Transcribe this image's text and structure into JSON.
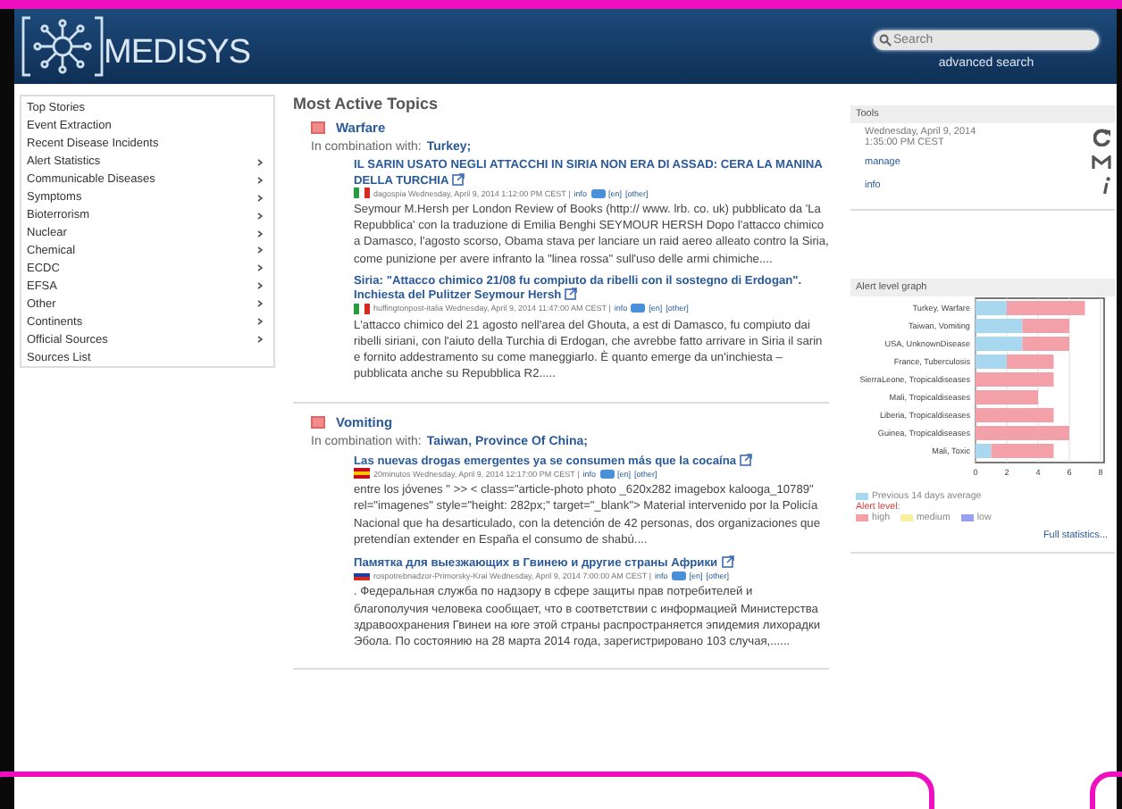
{
  "header": {
    "logo": "MEDISYS",
    "search": {
      "placeholder": "Search"
    },
    "advanced_search": "advanced search"
  },
  "sidebar": {
    "items": [
      {
        "label": "Top Stories",
        "has_submenu": false
      },
      {
        "label": "Event Extraction",
        "has_submenu": false
      },
      {
        "label": "Recent Disease Incidents",
        "has_submenu": false
      },
      {
        "label": "Alert Statistics",
        "has_submenu": true
      },
      {
        "label": "Communicable Diseases",
        "has_submenu": true
      },
      {
        "label": "Symptoms",
        "has_submenu": true
      },
      {
        "label": "Bioterrorism",
        "has_submenu": true
      },
      {
        "label": "Nuclear",
        "has_submenu": true
      },
      {
        "label": "Chemical",
        "has_submenu": true
      },
      {
        "label": "ECDC",
        "has_submenu": true
      },
      {
        "label": "EFSA",
        "has_submenu": true
      },
      {
        "label": "Other",
        "has_submenu": true
      },
      {
        "label": "Continents",
        "has_submenu": true
      },
      {
        "label": "Official Sources",
        "has_submenu": true
      },
      {
        "label": "Sources List",
        "has_submenu": false
      }
    ]
  },
  "main": {
    "title": "Most Active Topics",
    "topics": [
      {
        "name": "Warfare",
        "combination_label": "In combination with:",
        "combination": "Turkey;",
        "articles": [
          {
            "title": "IL SARIN USATO NEGLI ATTACCHI IN SIRIA NON ERA DI ASSAD: CERA LA MANINA DELLA TURCHIA",
            "kind": "it",
            "meta": "dagospia Wednesday, April 9, 2014 1:12:00 PM CEST |",
            "info": "info",
            "lang": "[en]",
            "other": "[other]",
            "body": "Seymour M.Hersh per London Review of Books (http:// www. lrb. co. uk) pubblicato da 'La Repubblica' con la traduzione di Emilia Benghi SEYMOUR HERSH Dopo l'attacco chimico a Damasco, l'agosto scorso, Obama stava per lanciare un raid aereo alleato contro la Siria, come punizione per avere infranto la \"linea rossa\" sull'uso delle armi chimiche...."
          },
          {
            "title": "Siria: \"Attacco chimico 21/08 fu compiuto da ribelli con il sostegno di Erdogan\". Inchiesta del Pulitzer Seymour Hersh",
            "kind": "it",
            "meta": "huffingtonpost-italia Wednesday, April 9, 2014 11:47:00 AM CEST |",
            "info": "info",
            "lang": "[en]",
            "other": "[other]",
            "body": "L'attacco chimico del 21 agosto nell'area del Ghouta, a est di Damasco, fu compiuto dai ribelli siriani, con l'aiuto della Turchia di Erdogan, che avrebbe fatto arrivare in Siria il sarin e fornito addestramento su come maneggiarlo. È quanto emerge da un'inchiesta – pubblicata anche su Repubblica R2....."
          }
        ]
      },
      {
        "name": "Vomiting",
        "combination_label": "In combination with:",
        "combination": "Taiwan, Province Of China;",
        "articles": [
          {
            "title": "Las nuevas drogas emergentes ya se consumen más que la cocaína",
            "kind": "es",
            "meta": "20minutos Wednesday, April 9, 2014 12:17:00 PM CEST |",
            "info": "info",
            "lang": "[en]",
            "other": "[other]",
            "body": "entre los jóvenes \" >> < class=\"article-photo photo _620x282 imagebox kalooga_10789\" rel=\"imagenes\" style=\"height: 282px;\" target=\"_blank\"> Material intervenido por la Policía Nacional que ha desarticulado, con la detención de 42 personas, dos organizaciones que pretendían extender en España el consumo de shabú...."
          },
          {
            "title": "Памятка для выезжающих в Гвинею и другие страны Африки",
            "kind": "ru",
            "meta": "rospotrebnadzor-Primorsky-Krai Wednesday, April 9, 2014 7:00:00 AM CEST |",
            "info": "info",
            "lang": "[en]",
            "other": "[other]",
            "body": ". Федеральная служба по надзору в сфере защиты прав потребителей и благополучия человека сообщает, что в соответствии с информацией Министерства здравоохранения Гвинеи на юге этой страны распространяется эпидемия лихорадки Эбола. По состоянию на 28 марта 2014 года, зарегистрировано 103 случая,......"
          }
        ]
      }
    ]
  },
  "tools": {
    "title": "Tools",
    "date": "Wednesday, April 9, 2014",
    "time": "1:35:00 PM CEST",
    "manage": "manage",
    "info": "info"
  },
  "alert_graph": {
    "title": "Alert level graph",
    "chart_data": {
      "type": "bar",
      "orientation": "horizontal",
      "stacked": true,
      "categories": [
        "Turkey, Warfare",
        "Taiwan, Vomiting",
        "USA, UnknownDisease",
        "France, Tuberculosis",
        "SierraLeone, Tropicaldiseases",
        "Mali, Tropicaldiseases",
        "Liberia, Tropicaldiseases",
        "Guinea, Tropicaldiseases",
        "Mali, Toxic"
      ],
      "series": [
        {
          "name": "Previous 14 days average",
          "color": "#a8d8f0",
          "values": [
            2,
            3,
            3,
            2,
            0,
            0,
            0,
            0,
            1
          ]
        },
        {
          "name": "high",
          "color": "#f4a0a8",
          "values": [
            5,
            3,
            3,
            3,
            5,
            4,
            5,
            6,
            4
          ]
        }
      ],
      "xlim": [
        0,
        8
      ],
      "xticks": [
        0,
        2,
        4,
        6,
        8
      ],
      "grid": true
    },
    "alert_level_label": "Alert level:",
    "levels": [
      {
        "label": "medium",
        "color": "#f8f0a0"
      },
      {
        "label": "low",
        "color": "#9aa0f0"
      }
    ],
    "full_statistics": "Full statistics..."
  }
}
